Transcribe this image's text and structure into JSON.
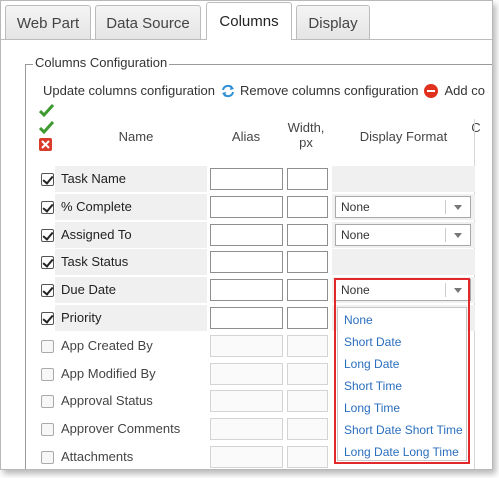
{
  "tabs": [
    {
      "label": "Web Part",
      "active": false
    },
    {
      "label": "Data Source",
      "active": false
    },
    {
      "label": "Columns",
      "active": true
    },
    {
      "label": "Display",
      "active": false
    }
  ],
  "fieldset": {
    "legend": "Columns Configuration"
  },
  "actions": {
    "update_label": "Update columns configuration",
    "remove_label": "Remove columns configuration",
    "add_label": "Add co"
  },
  "columns": {
    "name": "Name",
    "alias": "Alias",
    "width": "Width,",
    "width_unit": "px",
    "display_format": "Display Format",
    "extra": "C"
  },
  "rows": [
    {
      "name": "Task Name",
      "checked": true,
      "format": null
    },
    {
      "name": "% Complete",
      "checked": true,
      "format": "None"
    },
    {
      "name": "Assigned To",
      "checked": true,
      "format": "None"
    },
    {
      "name": "Task Status",
      "checked": true,
      "format": null
    },
    {
      "name": "Due Date",
      "checked": true,
      "format": "None"
    },
    {
      "name": "Priority",
      "checked": true,
      "format": null
    },
    {
      "name": "App Created By",
      "checked": false,
      "format": null
    },
    {
      "name": "App Modified By",
      "checked": false,
      "format": null
    },
    {
      "name": "Approval Status",
      "checked": false,
      "format": null
    },
    {
      "name": "Approver Comments",
      "checked": false,
      "format": null
    },
    {
      "name": "Attachments",
      "checked": false,
      "format": null
    }
  ],
  "dropdown": {
    "options": [
      "None",
      "Short Date",
      "Long Date",
      "Short Time",
      "Long Time",
      "Short Date Short Time",
      "Long Date Long Time"
    ]
  },
  "colors": {
    "link": "#2a6ebd",
    "highlight": "#e2282b",
    "check": "#3c9a2e",
    "remove": "#e0301e"
  }
}
